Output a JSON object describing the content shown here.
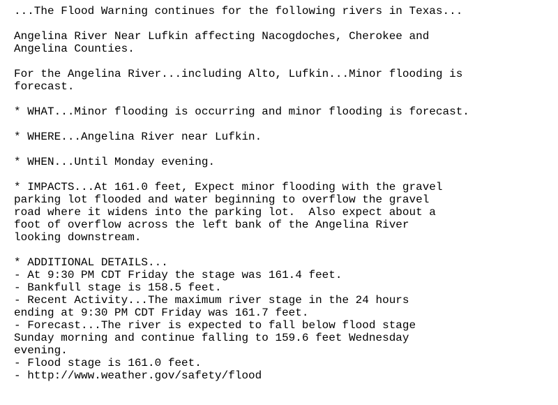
{
  "document": {
    "header": "...The Flood Warning continues for the following rivers in Texas...",
    "location_lines": [
      "Angelina River Near Lufkin affecting Nacogdoches, Cherokee and",
      "Angelina Counties."
    ],
    "forecast_lines": [
      "For the Angelina River...including Alto, Lufkin...Minor flooding is",
      "forecast."
    ],
    "what": "* WHAT...Minor flooding is occurring and minor flooding is forecast.",
    "where": "* WHERE...Angelina River near Lufkin.",
    "when": "* WHEN...Until Monday evening.",
    "impacts_lines": [
      "* IMPACTS...At 161.0 feet, Expect minor flooding with the gravel",
      "parking lot flooded and water beginning to overflow the gravel",
      "road where it widens into the parking lot.  Also expect about a",
      "foot of overflow across the left bank of the Angelina River",
      "looking downstream."
    ],
    "details_lines": [
      "* ADDITIONAL DETAILS...",
      "- At 9:30 PM CDT Friday the stage was 161.4 feet.",
      "- Bankfull stage is 158.5 feet.",
      "- Recent Activity...The maximum river stage in the 24 hours",
      "ending at 9:30 PM CDT Friday was 161.7 feet.",
      "- Forecast...The river is expected to fall below flood stage",
      "Sunday morning and continue falling to 159.6 feet Wednesday",
      "evening.",
      "- Flood stage is 161.0 feet.",
      "- http://www.weather.gov/safety/flood"
    ]
  }
}
